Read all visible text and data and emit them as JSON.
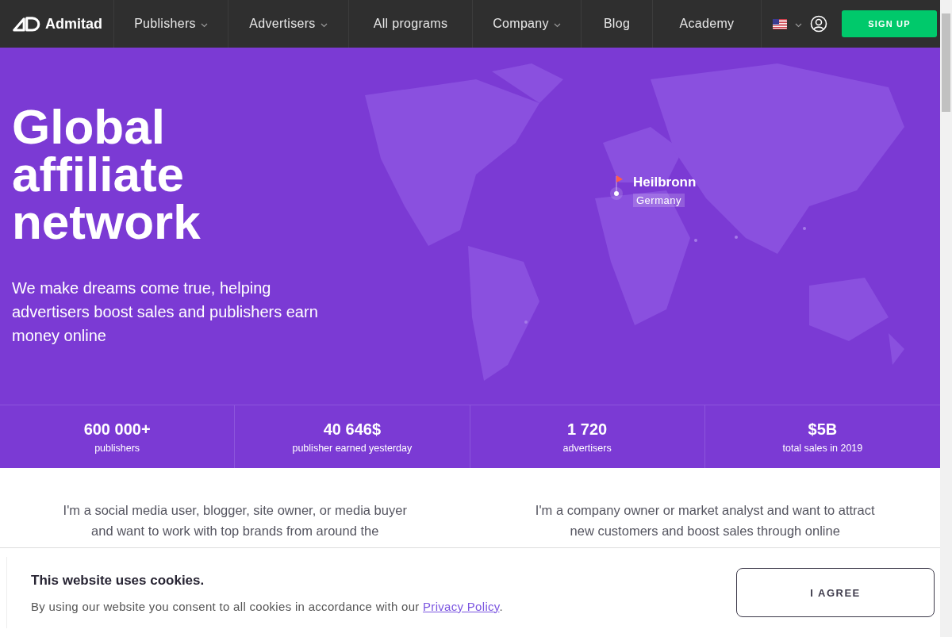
{
  "nav": {
    "logo": "Admitad",
    "items": [
      {
        "label": "Publishers",
        "dropdown": true
      },
      {
        "label": "Advertisers",
        "dropdown": true
      },
      {
        "label": "All programs",
        "dropdown": false
      },
      {
        "label": "Company",
        "dropdown": true
      },
      {
        "label": "Blog",
        "dropdown": false
      },
      {
        "label": "Academy",
        "dropdown": false
      }
    ],
    "signup": "SIGN UP"
  },
  "hero": {
    "title": "Global affiliate network",
    "subtitle": "We make dreams come true, helping advertisers boost sales and publishers earn money online",
    "marker": {
      "city": "Heilbronn",
      "country": "Germany"
    }
  },
  "stats": [
    {
      "value": "600 000+",
      "label": "publishers"
    },
    {
      "value": "40 646$",
      "label": "publisher earned yesterday"
    },
    {
      "value": "1 720",
      "label": "advertisers"
    },
    {
      "value": "$5B",
      "label": "total sales in 2019"
    }
  ],
  "audiences": [
    "I'm a social media user, blogger, site owner, or media buyer and want to work with top brands from around the",
    "I'm a company owner or market analyst and want to attract new customers and boost sales through online"
  ],
  "cookie": {
    "title": "This website uses cookies.",
    "text": "By using our website you consent to all cookies in accordance with our ",
    "link": "Privacy Policy",
    "after": ".",
    "button": "I AGREE"
  }
}
